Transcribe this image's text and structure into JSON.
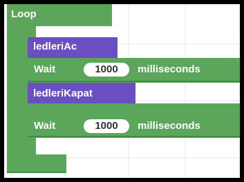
{
  "colors": {
    "loop_green": "#5ba65b",
    "loop_dark": "#3d8b3d",
    "purple": "#6a4ec2",
    "purple_dark": "#5237ad",
    "field_bg": "#ffffff",
    "window_bg": "#000000"
  },
  "loop": {
    "label": "Loop"
  },
  "blocks": [
    {
      "type": "call",
      "label": "ledleriAc"
    },
    {
      "type": "wait",
      "label": "Wait",
      "value": "1000",
      "unit": "milliseconds"
    },
    {
      "type": "call",
      "label": "ledleriKapat"
    },
    {
      "type": "wait",
      "label": "Wait",
      "value": "1000",
      "unit": "milliseconds"
    }
  ]
}
